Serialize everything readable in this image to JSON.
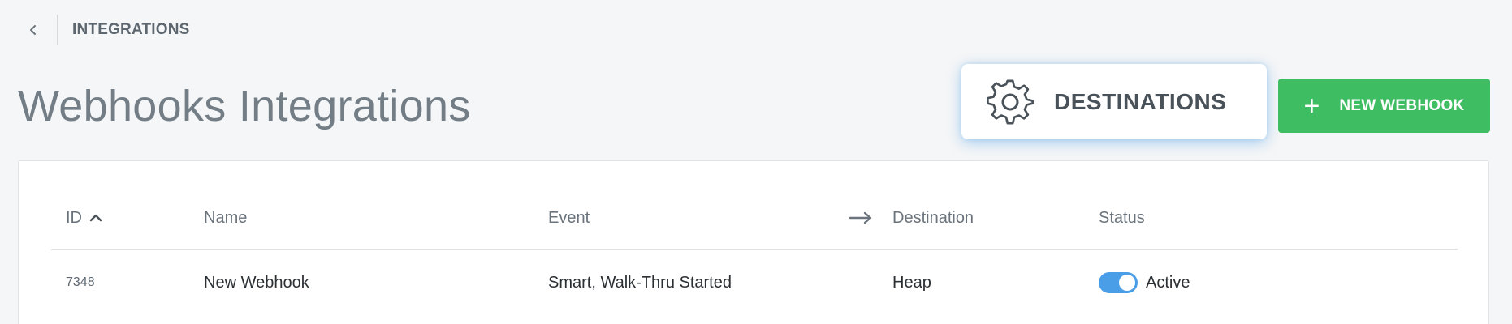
{
  "breadcrumb": {
    "label": "INTEGRATIONS"
  },
  "page": {
    "title": "Webhooks Integrations"
  },
  "destinations": {
    "label": "DESTINATIONS"
  },
  "new_webhook": {
    "plus": "+",
    "label": "NEW WEBHOOK"
  },
  "table": {
    "headers": {
      "id": "ID",
      "name": "Name",
      "event": "Event",
      "destination": "Destination",
      "status": "Status"
    },
    "rows": [
      {
        "id": "7348",
        "name": "New Webhook",
        "event": "Smart, Walk-Thru Started",
        "destination": "Heap",
        "status": "Active",
        "enabled": true
      }
    ]
  },
  "colors": {
    "accent_green": "#3fbd62",
    "accent_blue": "#4a9ee8",
    "title_gray": "#737d86"
  },
  "icons": {
    "back": "chevron-left-icon",
    "gear": "gear-icon",
    "sort": "chevron-up-icon",
    "arrow": "arrow-right-icon"
  }
}
